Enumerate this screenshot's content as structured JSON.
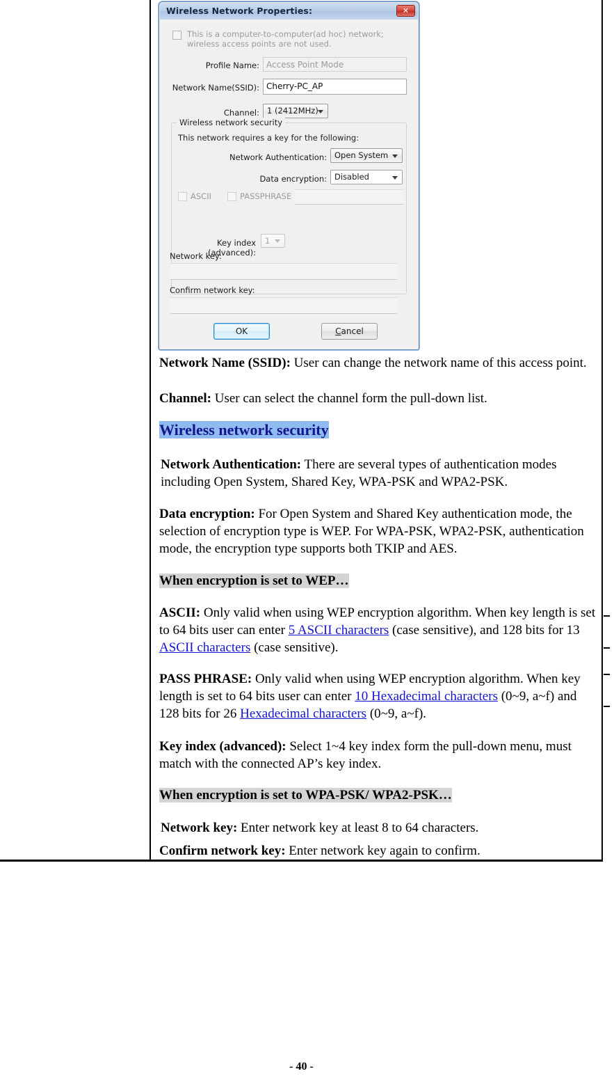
{
  "dialog": {
    "title": "Wireless Network Properties:",
    "close_label": "✕",
    "adhoc_checkbox_label": "This is a computer-to-computer(ad hoc) network; wireless access points are not used.",
    "profile_name_label": "Profile Name:",
    "profile_name_value": "Access Point Mode",
    "ssid_label": "Network Name(SSID):",
    "ssid_value": "Cherry-PC_AP",
    "channel_label": "Channel:",
    "channel_value": "1  (2412MHz)",
    "group_title": "Wireless network security",
    "group_hint": "This network requires a key for the following:",
    "auth_label": "Network Authentication:",
    "auth_value": "Open System",
    "encryption_label": "Data encryption:",
    "encryption_value": "Disabled",
    "ascii_label": "ASCII",
    "passphrase_label": "PASSPHRASE",
    "passphrase_value": "",
    "key_index_label": "Key index (advanced):",
    "key_index_value": "1",
    "network_key_label": "Network key:",
    "network_key_value": "",
    "confirm_key_label": "Confirm network key:",
    "confirm_key_value": "",
    "ok_label": "OK",
    "cancel_label_pre": "C",
    "cancel_label_post": "ancel",
    "colors": {
      "titlebar": "#bccfe8",
      "close_button": "#d44b3e",
      "default_button_border": "#2c8bd0"
    }
  },
  "doc": {
    "ssid_term": "Network Name (SSID):",
    "ssid_text": " User can change the network name of this access point.",
    "channel_term": "Channel:",
    "channel_text": " User can select the channel form the pull-down list.",
    "security_heading": "Wireless network security",
    "auth_term": "Network Authentication:",
    "auth_text": " There are several types of authentication modes including Open System, Shared Key, WPA-PSK and WPA2-PSK.",
    "encryption_term": "Data encryption:",
    "encryption_text": " For Open System and Shared Key authentication mode, the selection of encryption type is WEP. For WPA-PSK, WPA2-PSK, authentication mode, the encryption type supports both TKIP and AES.",
    "wep_heading": "When encryption is set to WEP…",
    "ascii_term": "ASCII:",
    "ascii_text_1": " Only valid when using WEP encryption algorithm. When key length is set to 64 bits user can enter ",
    "ascii_link_1": "5 ASCII characters",
    "ascii_text_2": " (case sensitive), and 128 bits for 13",
    "ascii_link_2": " ASCII characters",
    "ascii_text_3": " (case sensitive).",
    "passphrase_term": "PASS PHRASE:",
    "passphrase_text_1": " Only valid when using WEP encryption algorithm. When key length is set to 64 bits user can enter ",
    "passphrase_link_1": "10 Hexadecimal characters",
    "passphrase_text_2": " (0~9, a~f) and 128 bits for 26 ",
    "passphrase_link_2": "Hexadecimal characters",
    "passphrase_text_3": " (0~9, a~f).",
    "keyindex_term": "Key index (advanced):",
    "keyindex_text": " Select 1~4 key index form the pull-down menu, must match with the connected AP’s key index.",
    "wpa_heading": "When encryption is set to WPA-PSK/ WPA2-PSK…",
    "netkey_term": "Network key:",
    "netkey_text": " Enter network key at least 8 to 64 characters.",
    "confirmkey_term": "Confirm network key:",
    "confirmkey_text": " Enter network key again to confirm."
  },
  "footer": {
    "page_number": "- 40 -"
  }
}
